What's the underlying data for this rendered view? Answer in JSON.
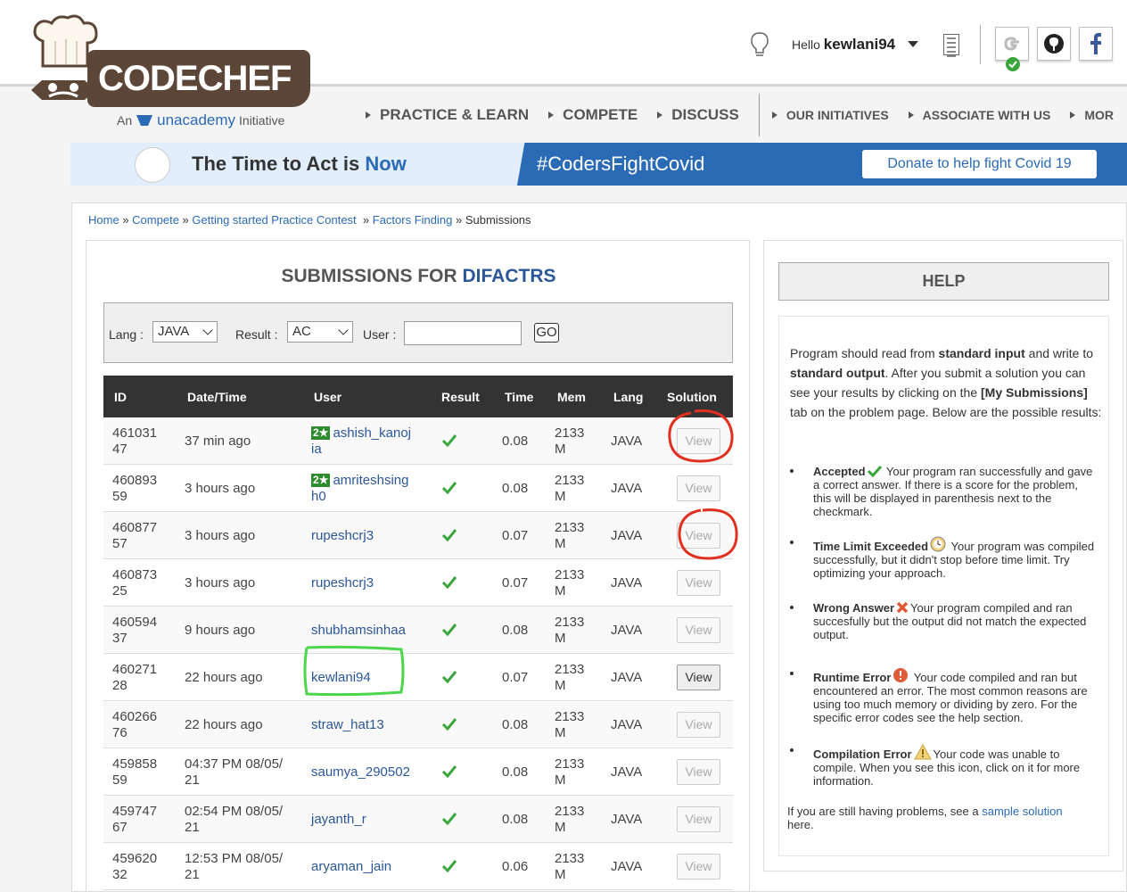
{
  "logo": {
    "wordmark": "CODECHEF",
    "tag_prefix": "An",
    "tag_brand": "unacademy",
    "tag_suffix": "Initiative"
  },
  "header": {
    "hello": "Hello",
    "username": "kewlani94",
    "icons": [
      "lightbulb-icon",
      "document-icon",
      "google-icon",
      "github-icon",
      "facebook-icon"
    ]
  },
  "nav": {
    "items": [
      "PRACTICE & LEARN",
      "COMPETE",
      "DISCUSS",
      "OUR INITIATIVES",
      "ASSOCIATE WITH US",
      "MOR"
    ]
  },
  "banner": {
    "text_a": "The Time to Act is",
    "text_b": "Now",
    "hashtag": "#CodersFightCovid",
    "donate": "Donate to help fight Covid 19"
  },
  "breadcrumb": {
    "home": "Home",
    "compete": "Compete",
    "contest": "Getting started Practice Contest",
    "problem": "Factors Finding",
    "current": "Submissions",
    "sep": "»"
  },
  "submissions": {
    "title_prefix": "SUBMISSIONS FOR",
    "title_code": "DIFACTRS",
    "filter": {
      "lang_label": "Lang :",
      "lang_value": "JAVA",
      "result_label": "Result :",
      "result_value": "AC",
      "user_label": "User :",
      "user_value": "",
      "go": "GO"
    },
    "columns": [
      "ID",
      "Date/Time",
      "User",
      "Result",
      "Time",
      "Mem",
      "Lang",
      "Solution"
    ],
    "rows": [
      {
        "id_a": "461031",
        "id_b": "47",
        "date_a": "37 min ago",
        "date_b": "",
        "badge": "2★",
        "user_a": "ashish_kanoj",
        "user_b": "ia",
        "time": "0.08",
        "mem_a": "2133",
        "mem_b": "M",
        "lang": "JAVA",
        "solution": "View"
      },
      {
        "id_a": "460893",
        "id_b": "59",
        "date_a": "3 hours ago",
        "date_b": "",
        "badge": "2★",
        "user_a": "amriteshsing",
        "user_b": "h0",
        "time": "0.08",
        "mem_a": "2133",
        "mem_b": "M",
        "lang": "JAVA",
        "solution": "View"
      },
      {
        "id_a": "460877",
        "id_b": "57",
        "date_a": "3 hours ago",
        "date_b": "",
        "badge": "",
        "user_a": "rupeshcrj3",
        "user_b": "",
        "time": "0.07",
        "mem_a": "2133",
        "mem_b": "M",
        "lang": "JAVA",
        "solution": "View"
      },
      {
        "id_a": "460873",
        "id_b": "25",
        "date_a": "3 hours ago",
        "date_b": "",
        "badge": "",
        "user_a": "rupeshcrj3",
        "user_b": "",
        "time": "0.07",
        "mem_a": "2133",
        "mem_b": "M",
        "lang": "JAVA",
        "solution": "View"
      },
      {
        "id_a": "460594",
        "id_b": "37",
        "date_a": "9 hours ago",
        "date_b": "",
        "badge": "",
        "user_a": "shubhamsinhaa",
        "user_b": "",
        "time": "0.08",
        "mem_a": "2133",
        "mem_b": "M",
        "lang": "JAVA",
        "solution": "View"
      },
      {
        "id_a": "460271",
        "id_b": "28",
        "date_a": "22 hours ago",
        "date_b": "",
        "badge": "",
        "user_a": "kewlani94",
        "user_b": "",
        "time": "0.07",
        "mem_a": "2133",
        "mem_b": "M",
        "lang": "JAVA",
        "solution": "View"
      },
      {
        "id_a": "460266",
        "id_b": "76",
        "date_a": "22 hours ago",
        "date_b": "",
        "badge": "",
        "user_a": "straw_hat13",
        "user_b": "",
        "time": "0.08",
        "mem_a": "2133",
        "mem_b": "M",
        "lang": "JAVA",
        "solution": "View"
      },
      {
        "id_a": "459858",
        "id_b": "59",
        "date_a": "04:37 PM 08/05/",
        "date_b": "21",
        "badge": "",
        "user_a": "saumya_290502",
        "user_b": "",
        "time": "0.08",
        "mem_a": "2133",
        "mem_b": "M",
        "lang": "JAVA",
        "solution": "View"
      },
      {
        "id_a": "459747",
        "id_b": "67",
        "date_a": "02:54 PM 08/05/",
        "date_b": "21",
        "badge": "",
        "user_a": "jayanth_r",
        "user_b": "",
        "time": "0.08",
        "mem_a": "2133",
        "mem_b": "M",
        "lang": "JAVA",
        "solution": "View"
      },
      {
        "id_a": "459620",
        "id_b": "32",
        "date_a": "12:53 PM 08/05/",
        "date_b": "21",
        "badge": "",
        "user_a": "aryaman_jain",
        "user_b": "",
        "time": "0.06",
        "mem_a": "2133",
        "mem_b": "M",
        "lang": "JAVA",
        "solution": "View"
      }
    ]
  },
  "help": {
    "title": "HELP",
    "intro_1": "Program should read from",
    "intro_b1": "standard input",
    "intro_2": "and write to",
    "intro_b2": "standard output",
    "intro_3": ". After you submit a solution you can see your results by clicking on the",
    "intro_b3": "[My Submissions]",
    "intro_4": "tab on the problem page. Below are the possible results:",
    "items": [
      {
        "name": "Accepted",
        "text": "Your program ran successfully and gave a correct answer. If there is a score for the problem, this will be displayed in parenthesis next to the checkmark."
      },
      {
        "name": "Time Limit Exceeded",
        "text": "Your program was compiled successfully, but it didn't stop before time limit. Try optimizing your approach."
      },
      {
        "name": "Wrong Answer",
        "text": "Your program compiled and ran succesfully but the output did not match the expected output."
      },
      {
        "name": "Runtime Error",
        "text": "Your code compiled and ran but encountered an error. The most common reasons are using too much memory or dividing by zero. For the specific error codes see the help section."
      },
      {
        "name": "Compilation Error",
        "text": "Your code was unable to compile. When you see this icon, click on it for more information."
      }
    ],
    "foot_a": "If you are still having problems, see a",
    "foot_link": "sample solution",
    "foot_b": "here."
  },
  "colors": {
    "accent": "#2b6ab5",
    "brand_brown": "#5b4638",
    "header_dark": "#333333",
    "check_green": "#3aa53a",
    "annotation_red": "#e03020",
    "annotation_green": "#4cd64c"
  }
}
